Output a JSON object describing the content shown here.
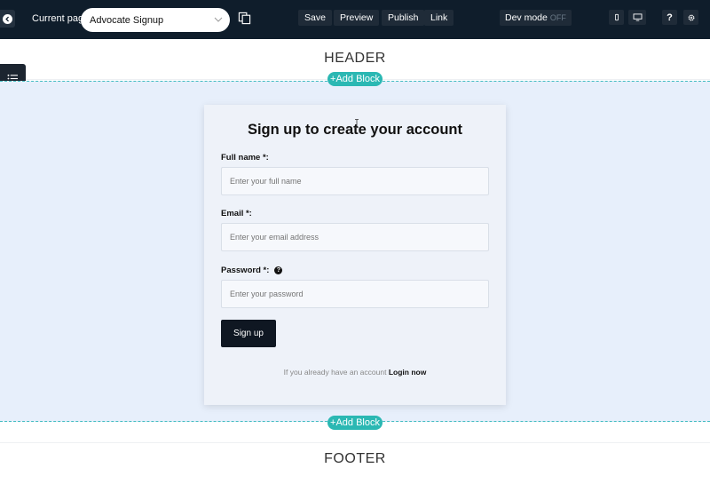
{
  "toolbar": {
    "current_page_label": "Current page",
    "page_select_value": "Advocate Signup",
    "save_label": "Save",
    "preview_label": "Preview",
    "publish_label": "Publish",
    "link_label": "Link",
    "dev_mode_label": "Dev mode",
    "dev_mode_state": "OFF",
    "help_label": "?"
  },
  "canvas": {
    "header_label": "HEADER",
    "footer_label": "FOOTER",
    "add_block_label": "+Add Block"
  },
  "form": {
    "title": "Sign up to create your account",
    "full_name_label": "Full name *:",
    "full_name_placeholder": "Enter your full name",
    "email_label": "Email *:",
    "email_placeholder": "Enter your email address",
    "password_label": "Password *:",
    "password_placeholder": "Enter your password",
    "submit_label": "Sign up",
    "login_prompt": "If you already have an account",
    "login_link": "Login now"
  },
  "colors": {
    "toolbar_bg": "#0f1d2b",
    "accent": "#2bb8b3",
    "block_bg": "#e7effb"
  }
}
